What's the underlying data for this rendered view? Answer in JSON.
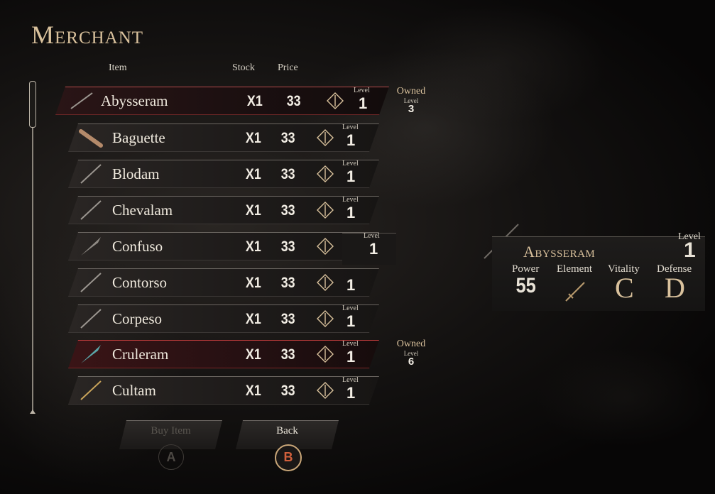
{
  "title": "Merchant",
  "headers": {
    "item": "Item",
    "stock": "Stock",
    "price": "Price"
  },
  "level_label": "Level",
  "items": [
    {
      "name": "Abysseram",
      "stock": "X1",
      "price": "33",
      "level": "1"
    },
    {
      "name": "Baguette",
      "stock": "X1",
      "price": "33",
      "level": "1"
    },
    {
      "name": "Blodam",
      "stock": "X1",
      "price": "33",
      "level": "1"
    },
    {
      "name": "Chevalam",
      "stock": "X1",
      "price": "33",
      "level": "1"
    },
    {
      "name": "Confuso",
      "stock": "X1",
      "price": "33",
      "level": "1"
    },
    {
      "name": "Contorso",
      "stock": "X1",
      "price": "33",
      "level": "1"
    },
    {
      "name": "Corpeso",
      "stock": "X1",
      "price": "33",
      "level": "1"
    },
    {
      "name": "Cruleram",
      "stock": "X1",
      "price": "33",
      "level": "1"
    },
    {
      "name": "Cultam",
      "stock": "X1",
      "price": "33",
      "level": "1"
    }
  ],
  "owned": [
    {
      "label": "Owned",
      "sub": "Level",
      "level": "3"
    },
    {
      "label": "Owned",
      "sub": "Level",
      "level": "6"
    }
  ],
  "tooltip": {
    "level_label": "Level",
    "level": "1"
  },
  "detail": {
    "name": "Abysseram",
    "level_label": "Level",
    "level": "1",
    "power_label": "Power",
    "power": "55",
    "element_label": "Element",
    "element_icon": "sword-icon",
    "vitality_label": "Vitality",
    "vitality": "C",
    "defense_label": "Defense",
    "defense": "D"
  },
  "buttons": {
    "buy": "Buy Item",
    "buy_key": "A",
    "back": "Back",
    "back_key": "B"
  },
  "colors": {
    "accent": "#d9c19c",
    "selected": "#b83a3a",
    "key_b": "#d2603c"
  }
}
